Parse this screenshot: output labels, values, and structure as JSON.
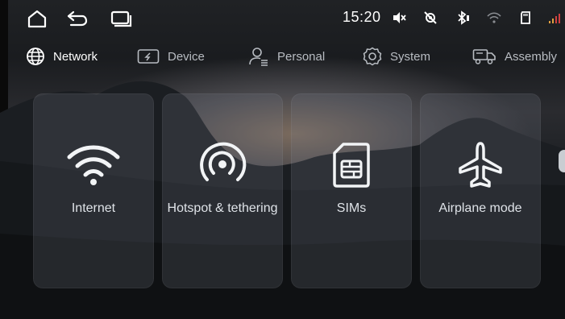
{
  "status": {
    "time": "15:20",
    "icons": [
      "mute-icon",
      "location-off-icon",
      "bluetooth-icon",
      "wifi-weak-icon",
      "sd-card-icon",
      "signal-icon"
    ]
  },
  "nav": {
    "icons": [
      "home-icon",
      "back-icon",
      "recent-apps-icon"
    ]
  },
  "tabs": [
    {
      "label": "Network",
      "icon": "globe-icon",
      "active": true
    },
    {
      "label": "Device",
      "icon": "device-icon",
      "active": false
    },
    {
      "label": "Personal",
      "icon": "person-icon",
      "active": false
    },
    {
      "label": "System",
      "icon": "gear-icon",
      "active": false
    },
    {
      "label": "Assembly",
      "icon": "truck-icon",
      "active": false
    }
  ],
  "cards": [
    {
      "label": "Internet",
      "icon": "wifi-icon"
    },
    {
      "label": "Hotspot & tethering",
      "icon": "hotspot-icon"
    },
    {
      "label": "SIMs",
      "icon": "sim-icon"
    },
    {
      "label": "Airplane mode",
      "icon": "airplane-icon"
    }
  ],
  "colors": {
    "accent": "#ffffff",
    "card_bg": "#787d87",
    "text": "#dfe3e8"
  }
}
